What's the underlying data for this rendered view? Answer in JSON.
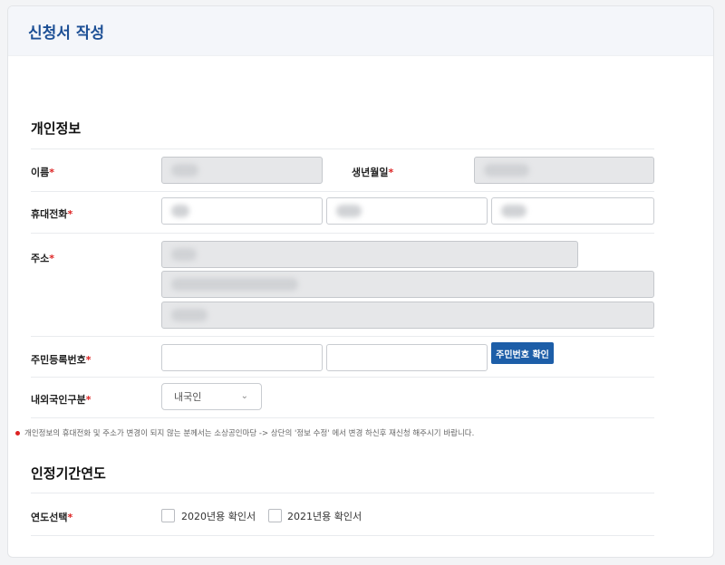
{
  "header": {
    "title": "신청서 작성"
  },
  "personal": {
    "section_title": "개인정보",
    "name_label": "이름",
    "birth_label": "생년월일",
    "phone_label": "휴대전화",
    "address_label": "주소",
    "rrn_label": "주민등록번호",
    "rrn_button": "주민번호 확인",
    "nationality_label": "내외국인구분",
    "nationality_value": "내국인",
    "required_mark": "*"
  },
  "note": "개인정보의 휴대전화 및 주소가 변경이 되지 않는 분께서는 소상공인마당 -> 상단의 '정보 수정' 에서 변경 하신후 재신청 해주시기 바랍니다.",
  "year": {
    "section_title": "인정기간연도",
    "select_label": "연도선택",
    "options": [
      "2020년용 확인서",
      "2021년용 확인서"
    ]
  },
  "colors": {
    "accent": "#1d5ea8",
    "title": "#1c4f95",
    "required": "#dd2222"
  }
}
